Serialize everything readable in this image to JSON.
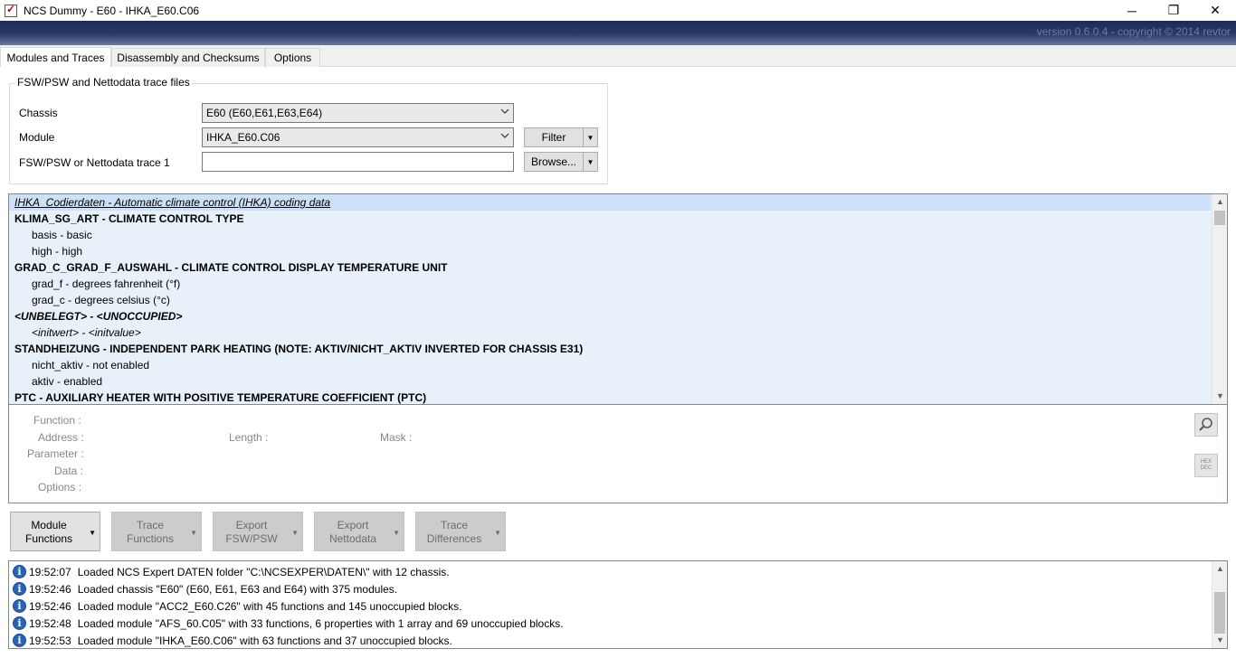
{
  "window": {
    "title": "NCS Dummy - E60 - IHKA_E60.C06",
    "minimize": "─",
    "maximize": "❐",
    "close": "✕"
  },
  "banner": {
    "version_text": "version 0.6.0.4 - copyright © 2014 revtor"
  },
  "tabs": [
    {
      "label": "Modules and Traces",
      "active": true
    },
    {
      "label": "Disassembly and Checksums",
      "active": false
    },
    {
      "label": "Options",
      "active": false
    }
  ],
  "trace_files": {
    "group_title": "FSW/PSW and Nettodata trace files",
    "chassis_label": "Chassis",
    "chassis_value": "E60  (E60,E61,E63,E64)",
    "module_label": "Module",
    "module_value": "IHKA_E60.C06",
    "trace_label": "FSW/PSW or Nettodata trace 1",
    "trace_value": "",
    "filter_label": "Filter",
    "browse_label": "Browse..."
  },
  "tree": {
    "header": "IHKA_Codierdaten  -  Automatic climate control (IHKA) coding data",
    "lines": [
      {
        "text": "KLIMA_SG_ART  -  CLIMATE CONTROL TYPE",
        "style": "bold"
      },
      {
        "text": "basis  -  basic",
        "style": "child"
      },
      {
        "text": "high  -  high",
        "style": "child"
      },
      {
        "text": "GRAD_C_GRAD_F_AUSWAHL  -  CLIMATE CONTROL DISPLAY TEMPERATURE UNIT",
        "style": "bold"
      },
      {
        "text": "grad_f  -  degrees fahrenheit (°f)",
        "style": "child"
      },
      {
        "text": "grad_c  -  degrees celsius (°c)",
        "style": "child"
      },
      {
        "text": "<UNBELEGT>  -  <UNOCCUPIED>",
        "style": "bold-italic"
      },
      {
        "text": "<initwert>  -  <initvalue>",
        "style": "child-italic"
      },
      {
        "text": "STANDHEIZUNG  -  INDEPENDENT PARK HEATING (NOTE: AKTIV/NICHT_AKTIV INVERTED FOR CHASSIS E31)",
        "style": "bold"
      },
      {
        "text": "nicht_aktiv  -  not enabled",
        "style": "child"
      },
      {
        "text": "aktiv  -  enabled",
        "style": "child"
      },
      {
        "text": "PTC  -  AUXILIARY HEATER WITH POSITIVE TEMPERATURE COEFFICIENT (PTC)",
        "style": "bold"
      }
    ]
  },
  "details": {
    "function_label": "Function :",
    "address_label": "Address :",
    "length_label": "Length :",
    "mask_label": "Mask :",
    "parameter_label": "Parameter :",
    "data_label": "Data :",
    "options_label": "Options :",
    "hexdec_label_top": "HEX",
    "hexdec_label_bottom": "DEC"
  },
  "actions": [
    {
      "line1": "Module",
      "line2": "Functions",
      "enabled": true
    },
    {
      "line1": "Trace",
      "line2": "Functions",
      "enabled": false
    },
    {
      "line1": "Export",
      "line2": "FSW/PSW",
      "enabled": false
    },
    {
      "line1": "Export",
      "line2": "Nettodata",
      "enabled": false
    },
    {
      "line1": "Trace",
      "line2": "Differences",
      "enabled": false
    }
  ],
  "log": [
    {
      "time": "19:52:07",
      "message": "Loaded NCS Expert DATEN folder \"C:\\NCSEXPER\\DATEN\\\" with 12 chassis."
    },
    {
      "time": "19:52:46",
      "message": "Loaded chassis \"E60\" (E60, E61, E63 and E64) with 375 modules."
    },
    {
      "time": "19:52:46",
      "message": "Loaded module \"ACC2_E60.C26\" with 45 functions and 145 unoccupied blocks."
    },
    {
      "time": "19:52:48",
      "message": "Loaded module \"AFS_60.C05\" with 33 functions, 6 properties with 1 array and 69 unoccupied blocks."
    },
    {
      "time": "19:52:53",
      "message": "Loaded module \"IHKA_E60.C06\" with 63 functions and 37 unoccupied blocks."
    }
  ]
}
